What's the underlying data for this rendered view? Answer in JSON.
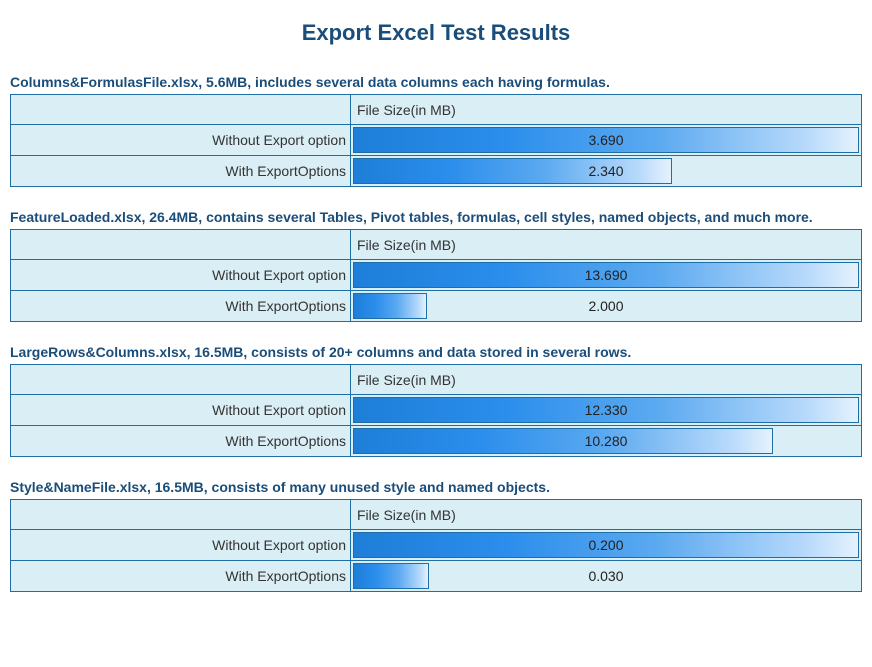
{
  "page_title": "Export Excel Test Results",
  "column_header": "File Size(in MB)",
  "row_labels": {
    "without": "Without Export option",
    "with": "With ExportOptions"
  },
  "sections": [
    {
      "title": "Columns&FormulasFile.xlsx, 5.6MB, includes several data columns each having formulas.",
      "without_value": "3.690",
      "without_pct": 100,
      "with_value": "2.340",
      "with_pct": 63
    },
    {
      "title": "FeatureLoaded.xlsx, 26.4MB, contains several Tables, Pivot tables, formulas, cell styles, named objects, and much more.",
      "without_value": "13.690",
      "without_pct": 100,
      "with_value": "2.000",
      "with_pct": 14.6
    },
    {
      "title": "LargeRows&Columns.xlsx, 16.5MB, consists of 20+ columns and data stored in several rows.",
      "without_value": "12.330",
      "without_pct": 100,
      "with_value": "10.280",
      "with_pct": 83
    },
    {
      "title": "Style&NameFile.xlsx, 16.5MB, consists of many unused style and named objects.",
      "without_value": "0.200",
      "without_pct": 100,
      "with_value": "0.030",
      "with_pct": 15
    }
  ],
  "chart_data": [
    {
      "type": "bar",
      "title": "Columns&FormulasFile.xlsx, 5.6MB, includes several data columns each having formulas.",
      "xlabel": "File Size(in MB)",
      "ylabel": "",
      "categories": [
        "Without Export option",
        "With ExportOptions"
      ],
      "values": [
        3.69,
        2.34
      ]
    },
    {
      "type": "bar",
      "title": "FeatureLoaded.xlsx, 26.4MB, contains several Tables, Pivot tables, formulas, cell styles, named objects, and much more.",
      "xlabel": "File Size(in MB)",
      "ylabel": "",
      "categories": [
        "Without Export option",
        "With ExportOptions"
      ],
      "values": [
        13.69,
        2.0
      ]
    },
    {
      "type": "bar",
      "title": "LargeRows&Columns.xlsx, 16.5MB, consists of 20+ columns and data stored in several rows.",
      "xlabel": "File Size(in MB)",
      "ylabel": "",
      "categories": [
        "Without Export option",
        "With ExportOptions"
      ],
      "values": [
        12.33,
        10.28
      ]
    },
    {
      "type": "bar",
      "title": "Style&NameFile.xlsx, 16.5MB, consists of many unused style and named objects.",
      "xlabel": "File Size(in MB)",
      "ylabel": "",
      "categories": [
        "Without Export option",
        "With ExportOptions"
      ],
      "values": [
        0.2,
        0.03
      ]
    }
  ]
}
